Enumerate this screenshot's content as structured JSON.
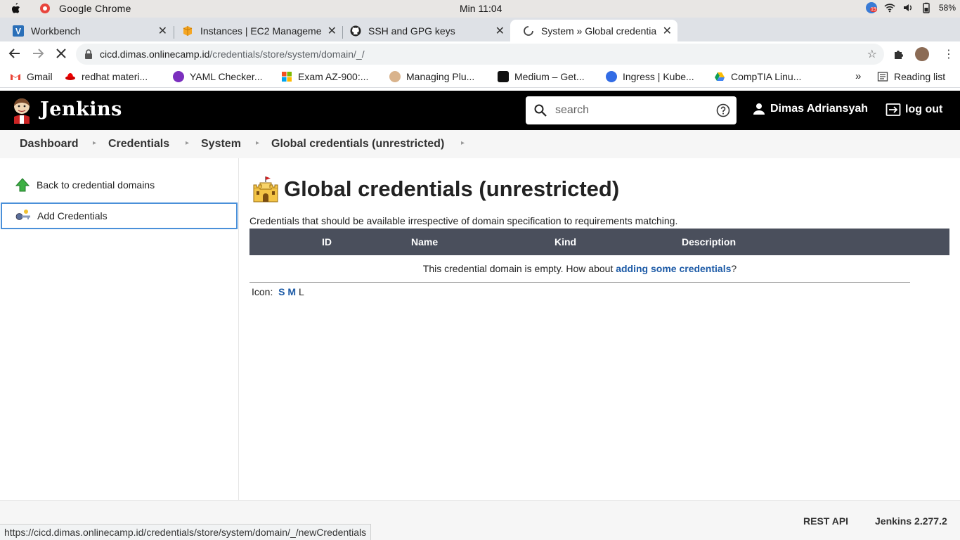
{
  "os": {
    "app_name": "Google Chrome",
    "clock": "Min 11:04",
    "notification_badge": "19",
    "battery": "58%"
  },
  "tabs": [
    {
      "title": "Workbench",
      "favicon": "vscode-icon"
    },
    {
      "title": "Instances | EC2 Manageme",
      "favicon": "aws-icon"
    },
    {
      "title": "SSH and GPG keys",
      "favicon": "github-icon"
    },
    {
      "title": "System » Global credentia",
      "favicon": "loading-spinner-icon",
      "active": true
    }
  ],
  "address": {
    "domain": "cicd.dimas.onlinecamp.id",
    "path": "/credentials/store/system/domain/_/"
  },
  "bookmarks": [
    {
      "label": "Gmail",
      "icon": "gmail-icon"
    },
    {
      "label": "redhat materi...",
      "icon": "redhat-icon"
    },
    {
      "label": "YAML Checker...",
      "icon": "yaml-icon"
    },
    {
      "label": "Exam AZ-900:...",
      "icon": "microsoft-icon"
    },
    {
      "label": "Managing Plu...",
      "icon": "jenkins-icon"
    },
    {
      "label": "Medium – Get...",
      "icon": "medium-icon"
    },
    {
      "label": "Ingress | Kube...",
      "icon": "kubernetes-icon"
    },
    {
      "label": "CompTIA Linu...",
      "icon": "drive-icon"
    }
  ],
  "bookmarks_more": "»",
  "reading_list": "Reading list",
  "jenkins": {
    "title": "Jenkins",
    "search_placeholder": "search",
    "user": "Dimas Adriansyah",
    "logout": "log out"
  },
  "breadcrumbs": [
    "Dashboard",
    "Credentials",
    "System",
    "Global credentials (unrestricted)"
  ],
  "sidebar": {
    "items": [
      {
        "label": "Back to credential domains",
        "icon": "up-arrow-icon"
      },
      {
        "label": "Add Credentials",
        "icon": "key-icon"
      }
    ]
  },
  "main": {
    "heading": "Global credentials (unrestricted)",
    "description": "Credentials that should be available irrespective of domain specification to requirements matching.",
    "columns": [
      "ID",
      "Name",
      "Kind",
      "Description"
    ],
    "empty_prefix": "This credential domain is empty. How about ",
    "empty_link": "adding some credentials",
    "empty_suffix": "?",
    "icon_label": "Icon:",
    "icon_sizes": [
      "S",
      "M",
      "L"
    ]
  },
  "footer": {
    "rest_api": "REST API",
    "version": "Jenkins 2.277.2"
  },
  "status_url": "https://cicd.dimas.onlinecamp.id/credentials/store/system/domain/_/newCredentials",
  "colors": {
    "header_bg": "#000000",
    "table_header_bg": "#4a4f5c",
    "link": "#1c5aa6",
    "selected_border": "#4a90d9"
  }
}
